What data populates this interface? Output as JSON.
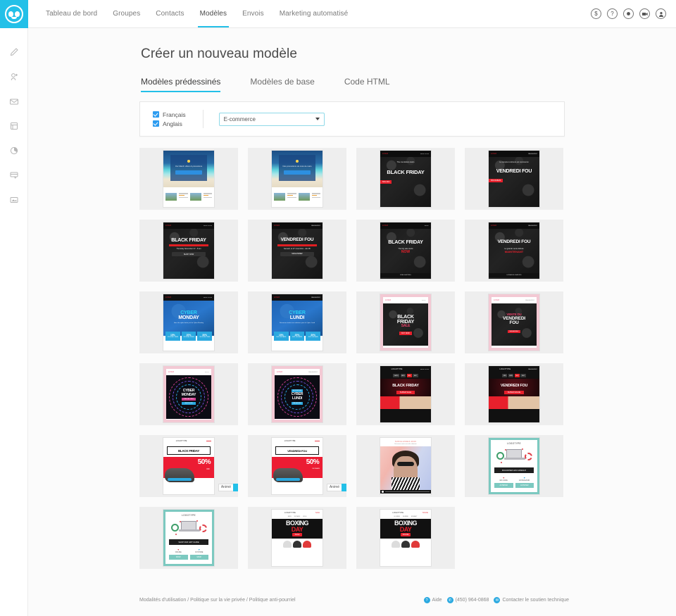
{
  "brand": {
    "logo_name": "owl-logo",
    "accent": "#23c0e8"
  },
  "topnav": {
    "items": [
      {
        "label": "Tableau de bord",
        "active": false
      },
      {
        "label": "Groupes",
        "active": false
      },
      {
        "label": "Contacts",
        "active": false
      },
      {
        "label": "Modèles",
        "active": true
      },
      {
        "label": "Envois",
        "active": false
      },
      {
        "label": "Marketing automatisé",
        "active": false
      }
    ],
    "icons": [
      {
        "name": "billing-icon",
        "glyph": "$"
      },
      {
        "name": "help-icon",
        "glyph": "?"
      },
      {
        "name": "record-icon",
        "glyph": "●"
      },
      {
        "name": "video-icon",
        "glyph": "▶"
      },
      {
        "name": "account-icon",
        "glyph": "👤"
      }
    ]
  },
  "sidebar": {
    "items": [
      {
        "name": "sidebar-item-edit",
        "icon": "pencil-icon"
      },
      {
        "name": "sidebar-item-add-contact",
        "icon": "add-contact-icon"
      },
      {
        "name": "sidebar-item-mail",
        "icon": "envelope-icon"
      },
      {
        "name": "sidebar-item-list",
        "icon": "list-icon"
      },
      {
        "name": "sidebar-item-stats",
        "icon": "pie-chart-icon"
      },
      {
        "name": "sidebar-item-form",
        "icon": "form-icon"
      },
      {
        "name": "sidebar-item-media",
        "icon": "media-icon"
      }
    ]
  },
  "page": {
    "title": "Créer un nouveau modèle",
    "tabs": [
      {
        "label": "Modèles prédessinés",
        "active": true
      },
      {
        "label": "Modèles de base",
        "active": false
      },
      {
        "label": "Code HTML",
        "active": false
      }
    ]
  },
  "filters": {
    "checkboxes": [
      {
        "label": "Français",
        "checked": true
      },
      {
        "label": "Anglais",
        "checked": true
      }
    ],
    "category_select": {
      "value": "E-commerce",
      "options": [
        "E-commerce"
      ]
    }
  },
  "templates": [
    {
      "id": 1,
      "style": "beach",
      "title": "Our March offers & promotions",
      "lang": "en",
      "badge": ""
    },
    {
      "id": 2,
      "style": "beach",
      "title": "Nos promotions du mois de mars",
      "lang": "fr",
      "badge": ""
    },
    {
      "id": 3,
      "style": "dark-bf",
      "title": "BLACK FRIDAY",
      "sub": "The countdown starts",
      "logo": "LOGO",
      "lang": "en",
      "badge": ""
    },
    {
      "id": 4,
      "style": "dark-bf",
      "title": "VENDREDI FOU",
      "sub": "Le compte à rebours est commencé",
      "logo": "LOGO",
      "lang": "fr",
      "badge": ""
    },
    {
      "id": 5,
      "style": "dark-bar",
      "title": "BLACK FRIDAY",
      "sub": "Thursday November 27 - 8 am",
      "logo": "LOGO",
      "lang": "en",
      "badge": ""
    },
    {
      "id": 6,
      "style": "dark-bar",
      "title": "VENDREDI FOU",
      "sub": "Samedi, le 27 novembre - dès 8h",
      "logo": "LOGO",
      "lang": "fr",
      "badge": ""
    },
    {
      "id": 7,
      "style": "dark-now",
      "title": "BLACK FRIDAY",
      "sub": "The big sale starts",
      "accent": "NOW",
      "logo": "LOGO",
      "lang": "en",
      "badge": ""
    },
    {
      "id": 8,
      "style": "dark-now",
      "title": "VENDREDI FOU",
      "sub": "La grande vente débute",
      "accent": "MAINTENANT",
      "logo": "LOGO",
      "lang": "fr",
      "badge": ""
    },
    {
      "id": 9,
      "style": "cyber-blue",
      "title1": "CYBER",
      "title2": "MONDAY",
      "sub": "Here the cyber deals just for Cyber Monday",
      "logo": "LOGO",
      "lang": "en",
      "badge": "",
      "tiles": [
        {
          "pct": "15%",
          "note": "ON SOME ITEMS"
        },
        {
          "pct": "20%",
          "note": "ON SOME ITEMS"
        },
        {
          "pct": "30%",
          "note": "ON SOME ITEMS"
        }
      ]
    },
    {
      "id": 10,
      "style": "cyber-blue",
      "title1": "CYBER",
      "title2": "LUNDI",
      "sub": "Découvrez toutes nos aubaines pour le Cyber Lundi",
      "logo": "LOGO",
      "lang": "fr",
      "badge": "",
      "tiles": [
        {
          "pct": "15%",
          "note": "SUR CERTAINS"
        },
        {
          "pct": "20%",
          "note": "SUR CERTAINS"
        },
        {
          "pct": "30%",
          "note": "SUR CERTAINS"
        }
      ]
    },
    {
      "id": 11,
      "style": "pink-sale",
      "title1": "BLACK",
      "title2": "FRIDAY",
      "accent": "SALE",
      "cta": "BUY NOW",
      "logo": "LOGO",
      "lang": "en",
      "badge": ""
    },
    {
      "id": 12,
      "style": "pink-sale",
      "title1": "VENTE DU",
      "title2": "VENDREDI",
      "title3": "FOU",
      "cta": "MAGASINEZ",
      "logo": "LOGO",
      "lang": "fr",
      "badge": ""
    },
    {
      "id": 13,
      "style": "circle-cyber",
      "title1": "CYBER",
      "title2": "MONDAY",
      "sub": "ONE DAY ONLY",
      "cta": "SHOP NOW",
      "logo": "LOGO",
      "lang": "en",
      "badge": ""
    },
    {
      "id": 14,
      "style": "circle-cyber",
      "title1": "CYBER",
      "title2": "LUNDI",
      "sub": "AUJOURD'HUI",
      "cta": "MAGASINEZ",
      "logo": "LOGO",
      "lang": "fr",
      "badge": ""
    },
    {
      "id": 15,
      "style": "countdown",
      "title": "BLACK FRIDAY",
      "tag": "SUPER SALE",
      "logo": "LOGOTYPE",
      "lang": "en",
      "badge": "",
      "countdown": [
        "DAYS",
        "HRS",
        "MIN",
        "SEC"
      ]
    },
    {
      "id": 16,
      "style": "countdown",
      "title": "VENDREDI FOU",
      "tag": "SUPER SOLDE",
      "logo": "LOGOTYPE",
      "lang": "fr",
      "badge": "",
      "countdown": [
        "JRS",
        "HRS",
        "MIN",
        "SEC"
      ]
    },
    {
      "id": 17,
      "style": "shoe",
      "title": "BLACK FRIDAY",
      "pct": "50%",
      "note": "OFF",
      "logo": "LOGOTYPE",
      "lang": "en",
      "badge": "Animé"
    },
    {
      "id": 18,
      "style": "shoe",
      "title": "VENDREDI FOU",
      "pct": "50%",
      "note": "DE RABAIS",
      "logo": "LOGOTYPE",
      "lang": "fr",
      "badge": "Animé"
    },
    {
      "id": 19,
      "style": "model",
      "title": "SUNGLASSES 2020",
      "sub": "Découvrez notre nouvelle collection",
      "lang": "en",
      "badge": ""
    },
    {
      "id": 20,
      "style": "teal",
      "title": "LOGOTYPE",
      "cta": "MAGASINEZ LES CADEAUX",
      "logo": "LOGOTYPE",
      "lang": "fr",
      "badge": "",
      "cols": [
        {
          "label": "EN LIGNE",
          "btn": "ACHETER"
        },
        {
          "label": "EN MAGASIN",
          "btn": "ACHETER"
        }
      ]
    },
    {
      "id": 21,
      "style": "teal",
      "title": "LOGOTYPE",
      "cta": "SHOP OUR GIFT GUIDE",
      "logo": "LOGOTYPE",
      "lang": "en",
      "badge": "",
      "cols": [
        {
          "label": "ONLINE",
          "btn": "SHOP"
        },
        {
          "label": "IN STORE",
          "btn": "SHOP"
        }
      ]
    },
    {
      "id": 22,
      "style": "boxing",
      "title1": "BOXING",
      "title2": "DAY",
      "tag": "SALE",
      "logo": "LOGOTYPE",
      "red": "SALE",
      "lang": "en",
      "badge": "",
      "nav": [
        "MEN",
        "WOMEN",
        "KIDS"
      ]
    },
    {
      "id": 23,
      "style": "boxing",
      "title1": "BOXING",
      "title2": "DAY",
      "tag": "SOLDE",
      "logo": "LOGOTYPE",
      "red": "SOLDE",
      "lang": "fr",
      "badge": "",
      "nav": [
        "HOMME",
        "FEMME",
        "ENFANT"
      ]
    }
  ],
  "footer": {
    "legal": "Modalités d'utilisation / Politique sur la vie privée / Politique anti-pourriel",
    "help_label": "Aide",
    "phone": "(450) 964-0868",
    "support_label": "Contacter le soutien technique"
  }
}
